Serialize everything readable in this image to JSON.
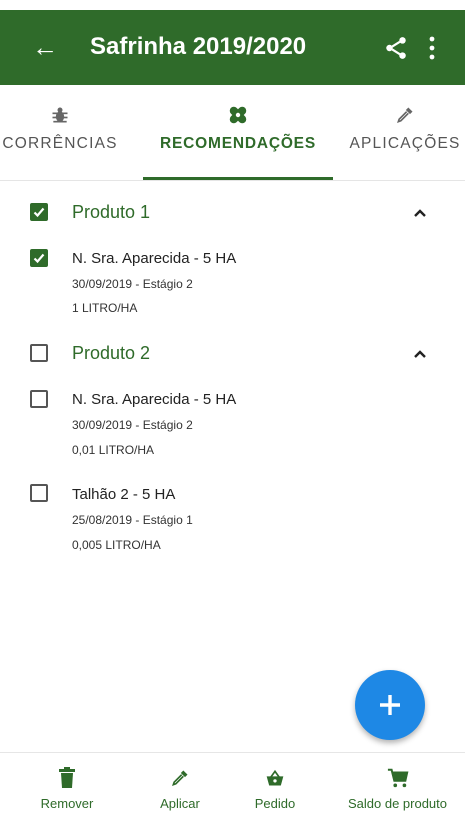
{
  "header": {
    "title": "Safrinha 2019/2020"
  },
  "tabs": [
    {
      "label": "CORRÊNCIAS",
      "icon": "bug-icon"
    },
    {
      "label": "RECOMENDAÇÕES",
      "icon": "bandage-icon",
      "active": true
    },
    {
      "label": "APLICAÇÕES",
      "icon": "dropper-icon"
    }
  ],
  "groups": [
    {
      "title": "Produto 1",
      "checked": true,
      "items": [
        {
          "title": "N. Sra. Aparecida - 5 HA",
          "date": "30/09/2019 - Estágio 2",
          "dose": "1 LITRO/HA",
          "checked": true
        }
      ]
    },
    {
      "title": "Produto 2",
      "checked": false,
      "items": [
        {
          "title": "N. Sra. Aparecida - 5 HA",
          "date": "30/09/2019 - Estágio 2",
          "dose": "0,01 LITRO/HA",
          "checked": false
        },
        {
          "title": "Talhão 2 - 5 HA",
          "date": "25/08/2019 - Estágio 1",
          "dose": "0,005 LITRO/HA",
          "checked": false
        }
      ]
    }
  ],
  "bottom_nav": [
    {
      "label": "Remover",
      "icon": "trash-icon"
    },
    {
      "label": "Aplicar",
      "icon": "dropper-icon"
    },
    {
      "label": "Pedido",
      "icon": "basket-icon"
    },
    {
      "label": "Saldo de produto",
      "icon": "cart-icon"
    }
  ],
  "colors": {
    "primary": "#2f6b2a",
    "fab": "#1e88e5"
  }
}
